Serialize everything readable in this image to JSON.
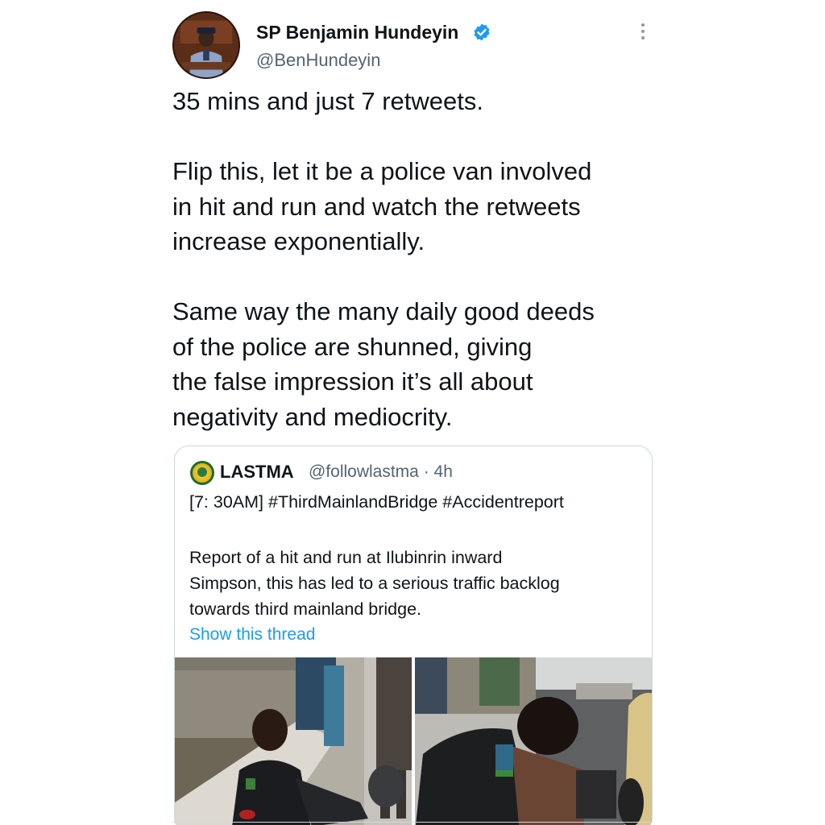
{
  "tweet": {
    "author_name": "SP Benjamin Hundeyin",
    "author_handle": "@BenHundeyin",
    "paragraphs": [
      [
        "35 mins and just 7 retweets."
      ],
      [
        "Flip this, let it be a police van involved",
        "in hit and run and watch the retweets",
        "increase exponentially."
      ],
      [
        "Same way the many daily good deeds",
        "of the police are shunned, giving",
        "the false impression it’s all about",
        "negativity and mediocrity."
      ]
    ]
  },
  "quoted_tweet": {
    "author_name": "LASTMA",
    "author_handle": "@followlastma · 4h",
    "headline": "[7: 30AM] #ThirdMainlandBridge #Accidentreport",
    "body_lines": [
      "Report of a hit and run at Ilubinrin inward",
      "Simpson, this has led to a serious traffic backlog",
      "towards third mainland bridge."
    ],
    "show_thread": "Show this thread"
  },
  "icons": {
    "verified": "verified-badge-icon",
    "more": "more-options-icon"
  },
  "colors": {
    "verified_blue": "#1d9bf0",
    "link_blue": "#1d9bf0",
    "secondary_text": "#536471",
    "border": "#cfd9de"
  }
}
